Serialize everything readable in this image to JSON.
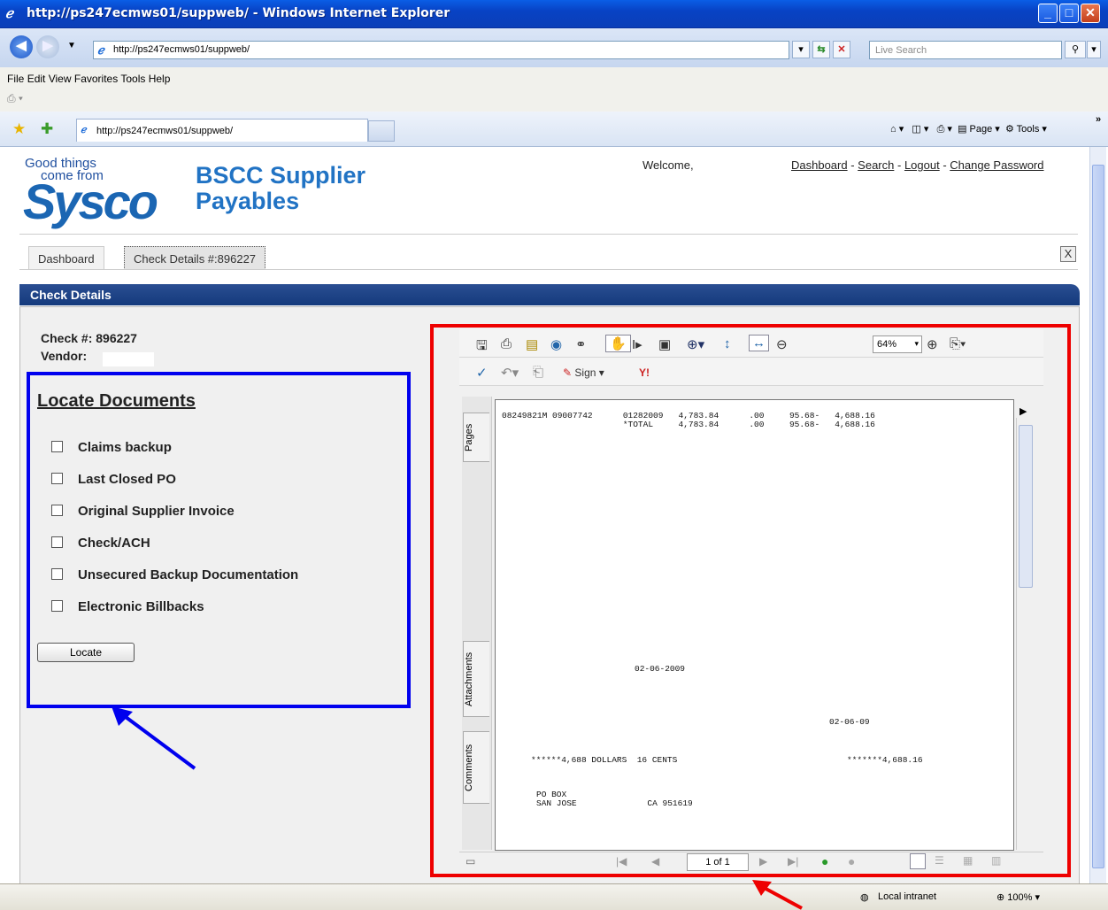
{
  "window": {
    "title": "http://ps247ecmws01/suppweb/ - Windows Internet Explorer"
  },
  "address": {
    "url": "http://ps247ecmws01/suppweb/",
    "search_placeholder": "Live Search"
  },
  "menu": [
    "File",
    "Edit",
    "View",
    "Favorites",
    "Tools",
    "Help"
  ],
  "favorites_tab": {
    "label": "http://ps247ecmws01/suppweb/"
  },
  "command_bar": {
    "page": "Page",
    "tools": "Tools"
  },
  "brand": {
    "line1": "Good things",
    "line2": "come from",
    "logo": "Sysco",
    "title_line1": "BSCC Supplier",
    "title_line2": "Payables"
  },
  "header": {
    "welcome": "Welcome,",
    "links": [
      "Dashboard",
      "Search",
      "Logout",
      "Change Password"
    ],
    "separator": " - "
  },
  "tabs": [
    {
      "label": "Dashboard"
    },
    {
      "label": "Check Details #:896227"
    }
  ],
  "panel": {
    "title": "Check Details"
  },
  "check": {
    "number_label": "Check #: 896227",
    "vendor_label": "Vendor:"
  },
  "locate": {
    "heading": "Locate Documents",
    "options": [
      "Claims backup",
      "Last Closed PO",
      "Original Supplier Invoice",
      "Check/ACH",
      "Unsecured Backup Documentation",
      "Electronic Billbacks"
    ],
    "button": "Locate"
  },
  "pdf": {
    "zoom": "64%",
    "sign_label": "Sign",
    "side_tabs": [
      "Pages",
      "Attachments",
      "Comments"
    ],
    "lines": [
      "08249821M 09007742      01282009   4,783.84      .00     95.68-   4,688.16",
      "                        *TOTAL     4,783.84      .00     95.68-   4,688.16"
    ],
    "date_long": "02-06-2009",
    "date_short": "02-06-09",
    "amount_words": "******4,688 DOLLARS  16 CENTS",
    "amount_num": "*******4,688.16",
    "address_line1": "PO BOX",
    "address_line2": "SAN JOSE              CA 951619",
    "page_indicator": "1 of 1"
  },
  "statusbar": {
    "zone": "Local intranet",
    "zoom": "100%"
  },
  "colors": {
    "highlight_left": "#0000ee",
    "highlight_right": "#ee0000",
    "header_blue": "#1e437f"
  }
}
